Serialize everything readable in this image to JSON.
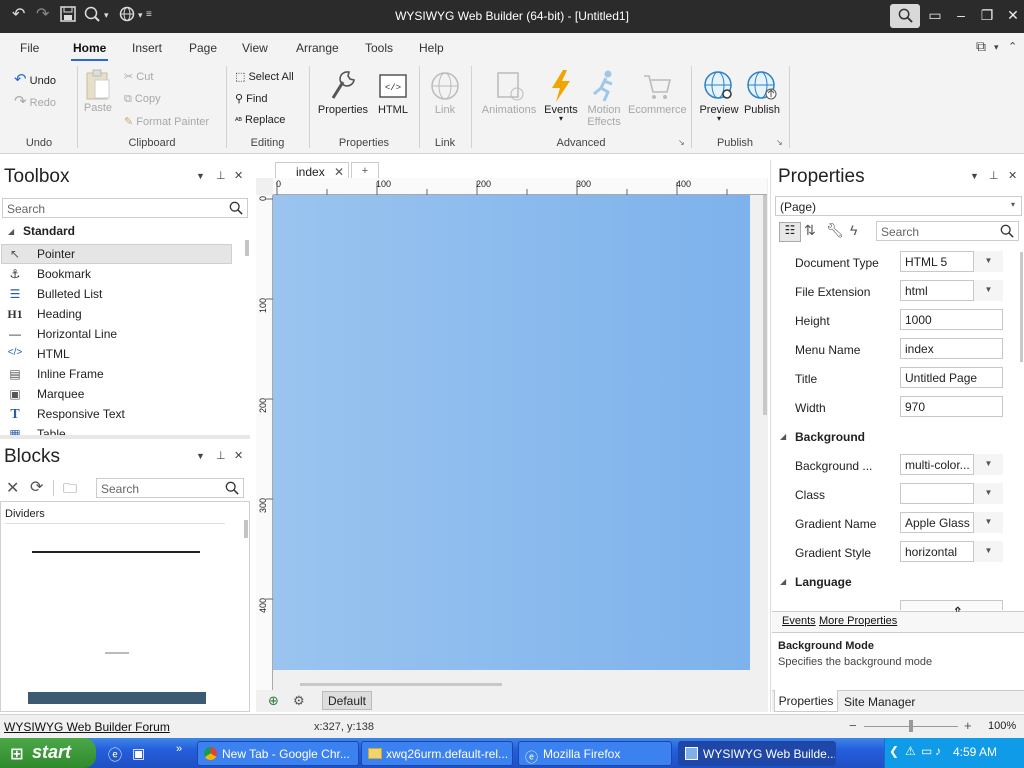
{
  "window": {
    "title": "WYSIWYG Web Builder (64-bit) - [Untitled1]"
  },
  "menu_tabs": [
    "File",
    "Home",
    "Insert",
    "Page",
    "View",
    "Arrange",
    "Tools",
    "Help"
  ],
  "ribbon": {
    "undo_label": "Undo",
    "redo_label": "Redo",
    "undo_group": "Undo",
    "paste_label": "Paste",
    "cut_label": "Cut",
    "copy_label": "Copy",
    "format_painter_label": "Format Painter",
    "clipboard_group": "Clipboard",
    "select_all_label": "Select All",
    "find_label": "Find",
    "replace_label": "Replace",
    "editing_group": "Editing",
    "properties_label": "Properties",
    "html_label": "HTML",
    "properties_group": "Properties",
    "link_label": "Link",
    "link_group": "Link",
    "animations_label": "Animations",
    "events_label": "Events",
    "motion_effects_label_1": "Motion",
    "motion_effects_label_2": "Effects",
    "ecommerce_label": "Ecommerce",
    "advanced_group": "Advanced",
    "preview_label": "Preview",
    "publish_label": "Publish",
    "publish_group": "Publish"
  },
  "toolbox": {
    "title": "Toolbox",
    "search_placeholder": "Search",
    "category": "Standard",
    "items": [
      {
        "label": "Pointer",
        "icon": "pointer-icon"
      },
      {
        "label": "Bookmark",
        "icon": "anchor-icon"
      },
      {
        "label": "Bulleted List",
        "icon": "list-icon"
      },
      {
        "label": "Heading",
        "icon": "heading-icon"
      },
      {
        "label": "Horizontal Line",
        "icon": "hline-icon"
      },
      {
        "label": "HTML",
        "icon": "code-icon"
      },
      {
        "label": "Inline Frame",
        "icon": "frame-icon"
      },
      {
        "label": "Marquee",
        "icon": "marquee-icon"
      },
      {
        "label": "Responsive Text",
        "icon": "text-icon"
      },
      {
        "label": "Table",
        "icon": "table-icon"
      }
    ]
  },
  "blocks": {
    "title": "Blocks",
    "search_placeholder": "Search",
    "category": "Dividers"
  },
  "document": {
    "tab_label": "index",
    "new_tab_label": "+",
    "ruler_h": [
      "0",
      "100",
      "200",
      "300",
      "400"
    ],
    "ruler_v": [
      "0",
      "100",
      "200",
      "300",
      "400"
    ],
    "layout_label": "Default"
  },
  "properties": {
    "title": "Properties",
    "object_select": "(Page)",
    "search_placeholder": "Search",
    "rows": [
      {
        "label": "Document Type",
        "value": "HTML 5",
        "dropdown": true
      },
      {
        "label": "File Extension",
        "value": "html",
        "dropdown": true
      },
      {
        "label": "Height",
        "value": "1000",
        "dropdown": false
      },
      {
        "label": "Menu Name",
        "value": "index",
        "dropdown": false
      },
      {
        "label": "Title",
        "value": "Untitled Page",
        "dropdown": false
      },
      {
        "label": "Width",
        "value": "970",
        "dropdown": false
      }
    ],
    "category_background": "Background",
    "bg_rows": [
      {
        "label": "Background ...",
        "value": "multi-color...",
        "dropdown": true
      },
      {
        "label": "Class",
        "value": "",
        "dropdown": true
      },
      {
        "label": "Gradient Name",
        "value": "Apple Glass",
        "dropdown": true
      },
      {
        "label": "Gradient Style",
        "value": "horizontal",
        "dropdown": true
      }
    ],
    "category_language": "Language",
    "events_link": "Events",
    "more_properties_link": "More Properties",
    "help_title": "Background Mode",
    "help_text": "Specifies the background mode",
    "bottom_tabs": [
      "Properties",
      "Site Manager"
    ]
  },
  "statusbar": {
    "forum_link": "WYSIWYG Web Builder Forum",
    "coords": "x:327, y:138",
    "zoom": "100%",
    "zoom_level": 0.5
  },
  "taskbar": {
    "start_label": "start",
    "tasks": [
      {
        "label": "New Tab - Google Chr...",
        "active": false
      },
      {
        "label": "xwq26urm.default-rel...",
        "active": false
      },
      {
        "label": "Mozilla Firefox",
        "active": false
      },
      {
        "label": "WYSIWYG Web Builde...",
        "active": true
      }
    ],
    "clock": "4:59 AM"
  }
}
